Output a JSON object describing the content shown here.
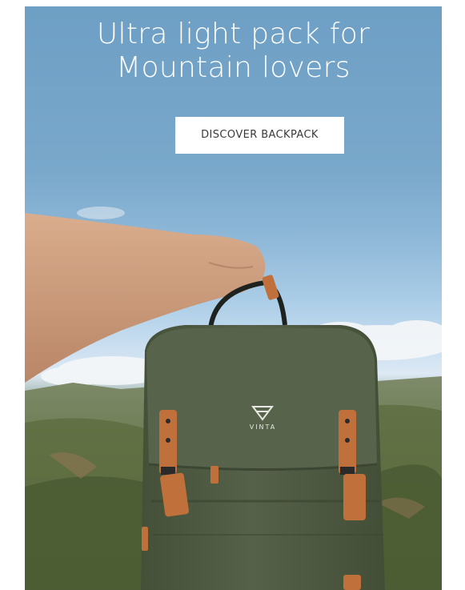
{
  "hero": {
    "headline_line1": "Ultra light pack for",
    "headline_line2": "Mountain lovers",
    "cta_label": "DISCOVER BACKPACK",
    "brand_name": "VINTA",
    "brand_icon": "vinta-logo-icon"
  },
  "colors": {
    "sky": "#79a8cb",
    "cta_background": "#ffffff",
    "cta_text": "#3a3a3a",
    "backpack": "#4f5a43",
    "leather": "#c0703a"
  }
}
